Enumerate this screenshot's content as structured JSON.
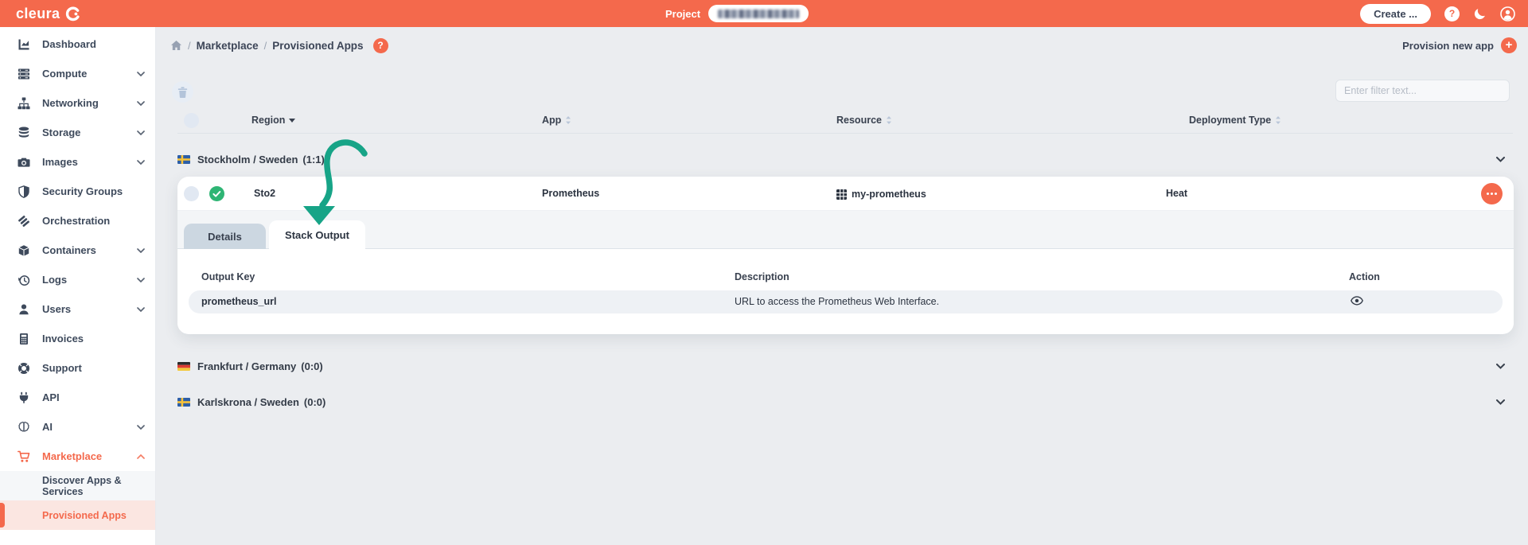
{
  "colors": {
    "accent": "#f4694c",
    "success": "#2eb574",
    "annotation": "#17a487"
  },
  "topbar": {
    "logo_text": "cleura",
    "project_label": "Project",
    "create_label": "Create ..."
  },
  "sidebar": {
    "items": [
      {
        "label": "Dashboard"
      },
      {
        "label": "Compute"
      },
      {
        "label": "Networking"
      },
      {
        "label": "Storage"
      },
      {
        "label": "Images"
      },
      {
        "label": "Security Groups"
      },
      {
        "label": "Orchestration"
      },
      {
        "label": "Containers"
      },
      {
        "label": "Logs"
      },
      {
        "label": "Users"
      },
      {
        "label": "Invoices"
      },
      {
        "label": "Support"
      },
      {
        "label": "API"
      },
      {
        "label": "AI"
      },
      {
        "label": "Marketplace"
      },
      {
        "label": "Discover Apps & Services"
      },
      {
        "label": "Provisioned Apps"
      }
    ]
  },
  "breadcrumb": {
    "separator": "/",
    "crumb1": "Marketplace",
    "crumb2": "Provisioned Apps"
  },
  "actions": {
    "provision_new_app": "Provision new app"
  },
  "filter": {
    "placeholder": "Enter filter text..."
  },
  "apps_table": {
    "columns": {
      "region": "Region",
      "app": "App",
      "resource": "Resource",
      "deployment_type": "Deployment Type"
    },
    "groups": [
      {
        "name": "Stockholm / Sweden",
        "count": "(1:1)"
      },
      {
        "name": "Frankfurt / Germany",
        "count": "(0:0)"
      },
      {
        "name": "Karlskrona / Sweden",
        "count": "(0:0)"
      }
    ],
    "row": {
      "region": "Sto2",
      "app": "Prometheus",
      "resource": "my-prometheus",
      "deployment_type": "Heat"
    }
  },
  "detail_tabs": {
    "details": "Details",
    "stack_output": "Stack Output"
  },
  "output_table": {
    "columns": {
      "key": "Output Key",
      "description": "Description",
      "action": "Action"
    },
    "rows": [
      {
        "key": "prometheus_url",
        "description": "URL to access the Prometheus Web Interface."
      }
    ]
  }
}
